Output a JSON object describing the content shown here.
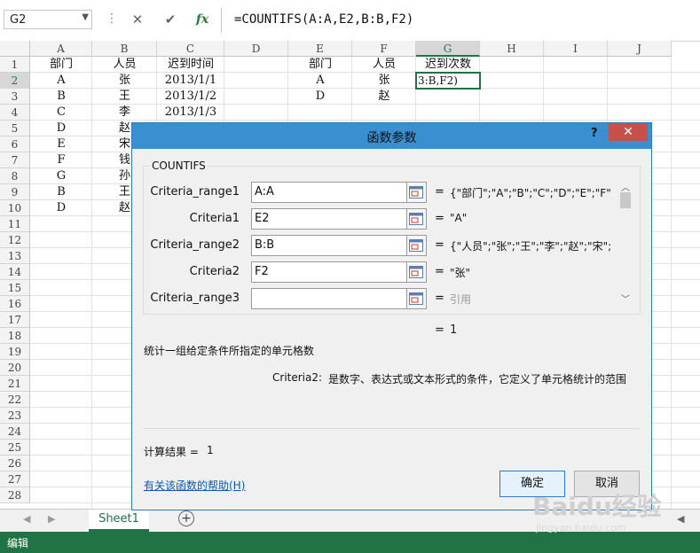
{
  "namebox": {
    "value": "G2"
  },
  "formula_bar": {
    "cancel_icon": "✕",
    "enter_icon": "✔",
    "fx_label": "fx",
    "formula": "=COUNTIFS(A:A,E2,B:B,F2)"
  },
  "columns": [
    "A",
    "B",
    "C",
    "D",
    "E",
    "F",
    "G",
    "H",
    "I",
    "J"
  ],
  "rows": [
    "1",
    "2",
    "3",
    "4",
    "5",
    "6",
    "7",
    "8",
    "9",
    "10",
    "11",
    "12",
    "13",
    "14",
    "15",
    "16",
    "17",
    "18",
    "19",
    "20",
    "21",
    "22",
    "23",
    "24",
    "25",
    "26",
    "27",
    "28"
  ],
  "cells": {
    "A": [
      "部门",
      "A",
      "B",
      "C",
      "D",
      "E",
      "F",
      "G",
      "B",
      "D"
    ],
    "B": [
      "人员",
      "张",
      "王",
      "李",
      "赵",
      "宋",
      "钱",
      "孙",
      "王",
      "赵"
    ],
    "C": [
      "迟到时间",
      "2013/1/1",
      "2013/1/2",
      "2013/1/3"
    ],
    "E": [
      "部门",
      "A",
      "D"
    ],
    "F": [
      "人员",
      "张",
      "赵"
    ],
    "G1": "迟到次数",
    "G2": "3:B,F2)"
  },
  "sheet": {
    "tab": "Sheet1",
    "add": "+"
  },
  "status": {
    "mode": "编辑"
  },
  "dialog": {
    "title": "函数参数",
    "help": "?",
    "close": "✕",
    "func_name": "COUNTIFS",
    "args": [
      {
        "name": "Criteria_range1",
        "value": "A:A",
        "result": "{\"部门\";\"A\";\"B\";\"C\";\"D\";\"E\";\"F\";\"G"
      },
      {
        "name": "Criteria1",
        "value": "E2",
        "result": "\"A\""
      },
      {
        "name": "Criteria_range2",
        "value": "B:B",
        "result": "{\"人员\";\"张\";\"王\";\"李\";\"赵\";\"宋\";\"钱"
      },
      {
        "name": "Criteria2",
        "value": "F2",
        "result": "\"张\""
      },
      {
        "name": "Criteria_range3",
        "value": "",
        "result": "引用"
      }
    ],
    "eq": "=",
    "result": "1",
    "description": "统计一组给定条件所指定的单元格数",
    "arg_desc_name": "Criteria2:",
    "arg_desc_text": "是数字、表达式或文本形式的条件，它定义了单元格统计的范围",
    "calc_label": "计算结果 =",
    "calc_value": "1",
    "help_link": "有关该函数的帮助(H)",
    "ok": "确定",
    "cancel": "取消"
  },
  "watermark": {
    "text": "Baidu经验",
    "sub": "jingyan.baidu.com"
  }
}
